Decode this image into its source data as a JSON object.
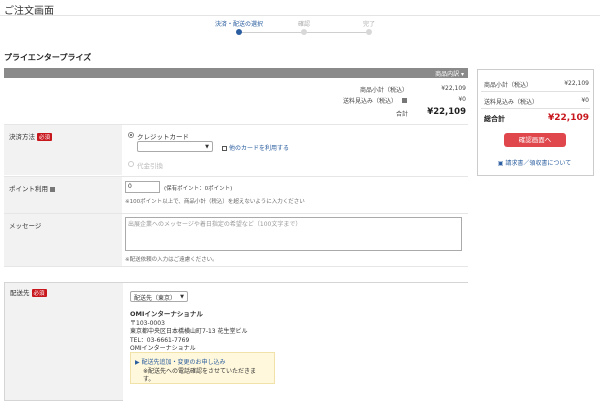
{
  "page": {
    "title": "ご注文画面"
  },
  "steps": [
    {
      "label": "決済・配送の選択",
      "active": true
    },
    {
      "label": "確認",
      "active": false
    },
    {
      "label": "完了",
      "active": false
    }
  ],
  "shop": {
    "name": "プライエンタープライズ"
  },
  "bar": {
    "label": "商品内訳 ▾"
  },
  "summary": {
    "subtotal_label": "商品小計（税込）",
    "subtotal_value": "¥22,109",
    "shipping_label": "送料見込み（税込）",
    "shipping_value": "¥0",
    "total_label": "合計",
    "total_value": "¥22,109"
  },
  "payment": {
    "label": "決済方法",
    "required": "必須",
    "option_card": "クレジットカード",
    "select_value": "",
    "other_card_link": "他のカードを利用する",
    "option_cod": "代金引換"
  },
  "points": {
    "label": "ポイント利用",
    "value": "0",
    "hint": "(保有ポイント：0ポイント)",
    "note": "※100ポイント以上で、商品小計（税込）を超えないように入力ください"
  },
  "message": {
    "label": "メッセージ",
    "placeholder": "出展企業へのメッセージや着日指定の希望など（100文字まで）",
    "note": "※配送依頼の入力はご遠慮ください。"
  },
  "shipping": {
    "label": "配送先",
    "required": "必須",
    "select_value": "配送先（東京）",
    "company": "OMIインターナショナル",
    "postal": "〒103-0003",
    "address": "東京都中央区日本橋横山町7-13 花生堂ビル",
    "tel": "TEL：03-6661-7769",
    "recipient": "OMIインターナショナル",
    "link": "配送先追加・変更のお申し込み",
    "note1": "※配送先への電話確認をさせていただきま",
    "note2": "す。"
  },
  "side": {
    "subtotal_label": "商品小計（税込）",
    "subtotal_value": "¥22,109",
    "shipping_label": "送料見込み（税込）",
    "shipping_value": "¥0",
    "total_label": "総合計",
    "total_value": "¥22,109",
    "confirm_button": "確認画面へ",
    "invoice_link": "請求書／領収書について"
  },
  "colors": {
    "accent_red": "#e0474c",
    "link_blue": "#2a5d9f",
    "required_red": "#c8161d"
  }
}
